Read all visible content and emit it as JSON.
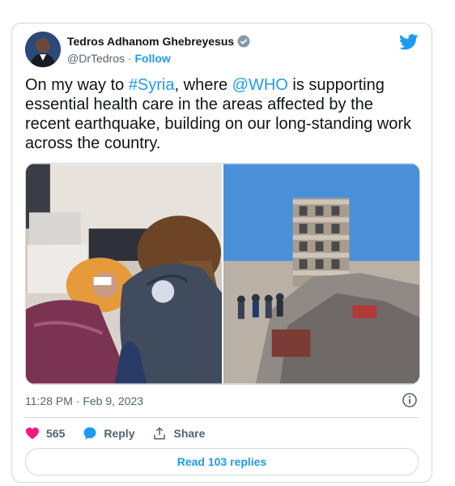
{
  "author": {
    "name": "Tedros Adhanom Ghebreyesus",
    "handle": "@DrTedros",
    "separator": "·",
    "follow_label": "Follow"
  },
  "tweet": {
    "text_1": "On my way to ",
    "hashtag": "#Syria",
    "text_2": ", where ",
    "mention": "@WHO",
    "text_3": " is supporting essential health care in the areas affected by the recent earthquake, building on our long-standing work across the country."
  },
  "meta": {
    "timestamp": "11:28 PM · Feb 9, 2023"
  },
  "actions": {
    "likes": "565",
    "reply_label": "Reply",
    "share_label": "Share"
  },
  "read_replies_label": "Read 103 replies",
  "colors": {
    "accent": "#1d9bf0",
    "heart": "#f91880",
    "border": "#cfd9de"
  }
}
